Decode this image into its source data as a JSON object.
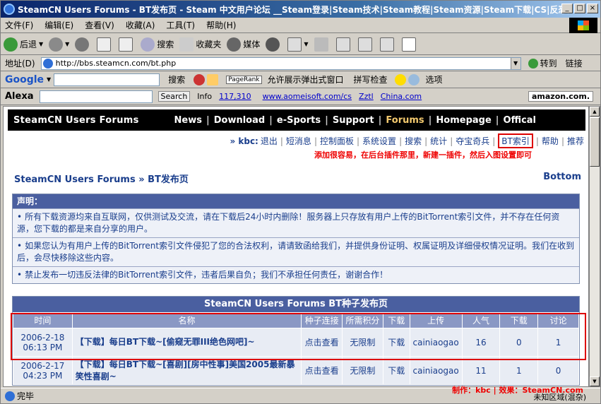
{
  "window": {
    "title": "SteamCN Users Forums - BT发布页 - Steam 中文用户论坛 __Steam登录|Steam技术|Steam教程|Steam资源|Steam下载|CS|反恐精...",
    "minimize": "_",
    "maximize": "□",
    "close": "×"
  },
  "menu": [
    "文件(F)",
    "编辑(E)",
    "查看(V)",
    "收藏(A)",
    "工具(T)",
    "帮助(H)"
  ],
  "toolbar": {
    "back": "后退",
    "search": "搜索",
    "favorites": "收藏夹",
    "media": "媒体"
  },
  "address": {
    "label": "地址(D)",
    "url": "http://bbs.steamcn.com/bt.php",
    "go": "转到",
    "links": "链接"
  },
  "google": {
    "logo": "Google",
    "search": "搜索",
    "pagerank": "PageRank",
    "popup": "允许展示弹出式窗口",
    "spell": "拼写检查",
    "options": "选项"
  },
  "alexa": {
    "logo": "Alexa",
    "search": "Search",
    "info": "Info",
    "count": "117,310",
    "link1": "www.aomeisoft.com/cs",
    "link2": "Zztl",
    "link3": "China.com",
    "amazon": "amazon.com."
  },
  "site": {
    "brand": "SteamCN Users Forums",
    "nav": [
      "News",
      "Download",
      "e-Sports",
      "Support",
      "Forums",
      "Homepage",
      "Offical"
    ],
    "user": "» kbc:",
    "userlinks": [
      "退出",
      "短消息",
      "控制面板",
      "系统设置",
      "搜索",
      "统计",
      "夺宝奇兵",
      "BT索引",
      "帮助",
      "推荐"
    ],
    "note": "添加很容易，在后台插件那里，新建一插件，然后入图设置即可",
    "breadcrumb": "SteamCN Users Forums » BT发布页",
    "bottom": "Bottom"
  },
  "notice": {
    "header": "声明：",
    "items": [
      "所有下载资源均来自互联网，仅供测试及交流，请在下载后24小时内删除！服务器上只存放有用户上传的BitTorrent索引文件，并不存在任何资源，您下载的都是来自分享的用户。",
      "如果您认为有用户上传的BitTorrent索引文件侵犯了您的合法权利，请请致函给我们，并提供身份证明、权属证明及详细侵权情况证明。我们在收到后，会尽快移除这些内容。",
      "禁止发布一切违反法律的BitTorrent索引文件，违者后果自负；我们不承担任何责任，谢谢合作！"
    ]
  },
  "torrents": {
    "caption": "SteamCN Users Forums BT种子发布页",
    "headers": [
      "时间",
      "名称",
      "种子连接",
      "所需积分",
      "下载",
      "上传",
      "人气",
      "下载",
      "讨论"
    ],
    "rows": [
      {
        "date": "2006-2-18",
        "time": "06:13 PM",
        "name": "【下载】每日BT下载~[偷窥无罪III绝色网吧]~",
        "link": "点击查看",
        "points": "无限制",
        "dl": "下载",
        "uploader": "cainiaogao",
        "hits": "16",
        "downloads": "0",
        "replies": "1"
      },
      {
        "date": "2006-2-17",
        "time": "04:23 PM",
        "name": "【下载】每日BT下载~[喜剧][房中性事]美国2005最新暴笑性喜剧~",
        "link": "点击查看",
        "points": "无限制",
        "dl": "下载",
        "uploader": "cainiaogao",
        "hits": "11",
        "downloads": "1",
        "replies": "0"
      }
    ]
  },
  "status": {
    "text": "完毕",
    "credit": "制作：kbc | 效果：SteamCN.com",
    "zone": "未知区域(混杂)"
  },
  "colors": {
    "titlebar": "#0a246a",
    "header": "#4a5fa0",
    "link": "#1a3e8c",
    "accent": "#dd0000"
  }
}
